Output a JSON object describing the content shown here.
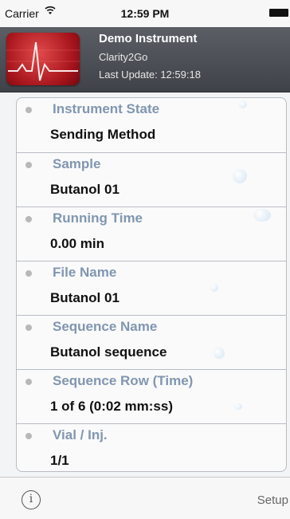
{
  "status_bar": {
    "carrier": "Carrier",
    "time": "12:59 PM"
  },
  "header": {
    "title": "Demo Instrument",
    "subtitle": "Clarity2Go",
    "last_update": "Last Update: 12:59:18",
    "icon": "heartbeat-icon"
  },
  "fields": [
    {
      "label": "Instrument State",
      "value": "Sending Method"
    },
    {
      "label": "Sample",
      "value": "Butanol 01"
    },
    {
      "label": "Running Time",
      "value": "0.00 min"
    },
    {
      "label": "File Name",
      "value": "Butanol 01"
    },
    {
      "label": "Sequence Name",
      "value": "Butanol sequence"
    },
    {
      "label": "Sequence Row (Time)",
      "value": "1 of 6 (0:02 mm:ss)"
    },
    {
      "label": "Vial / Inj.",
      "value": "1/1"
    }
  ],
  "toolbar": {
    "info_label": "i",
    "setup_label": "Setup"
  },
  "colors": {
    "label": "#8196b0",
    "header": "#4a4e54",
    "accent": "#a3121a"
  }
}
